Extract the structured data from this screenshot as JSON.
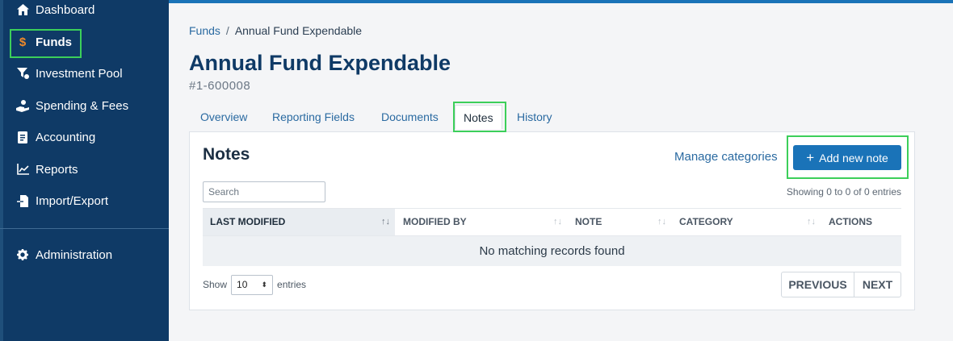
{
  "sidebar": {
    "items": [
      {
        "label": "Dashboard",
        "icon": "home-icon"
      },
      {
        "label": "Funds",
        "icon": "dollar-icon",
        "active": true
      },
      {
        "label": "Investment Pool",
        "icon": "funnel-icon"
      },
      {
        "label": "Spending & Fees",
        "icon": "hand-coin-icon"
      },
      {
        "label": "Accounting",
        "icon": "ledger-icon"
      },
      {
        "label": "Reports",
        "icon": "line-chart-icon"
      },
      {
        "label": "Import/Export",
        "icon": "import-file-icon"
      }
    ],
    "admin": {
      "label": "Administration",
      "icon": "gear-icon"
    }
  },
  "breadcrumb": {
    "root": "Funds",
    "separator": "/",
    "current": "Annual Fund Expendable"
  },
  "page": {
    "title": "Annual Fund Expendable",
    "fund_number": "#1-600008"
  },
  "tabs": [
    "Overview",
    "Reporting Fields",
    "Documents",
    "Notes",
    "History"
  ],
  "notes": {
    "title": "Notes",
    "manage_categories": "Manage categories",
    "add_button": "Add new note",
    "search_placeholder": "Search",
    "showing_text": "Showing 0 to 0 of 0 entries",
    "columns": [
      "LAST MODIFIED",
      "MODIFIED BY",
      "NOTE",
      "CATEGORY",
      "ACTIONS"
    ],
    "empty_message": "No matching records found",
    "show_label": "Show",
    "page_size": "10",
    "entries_label": "entries",
    "previous": "PREVIOUS",
    "next": "NEXT"
  },
  "colors": {
    "sidebar_bg": "#0f3a66",
    "accent": "#1a73b8",
    "highlight": "#3ccf5a",
    "dollar_icon": "#f08a2a"
  }
}
